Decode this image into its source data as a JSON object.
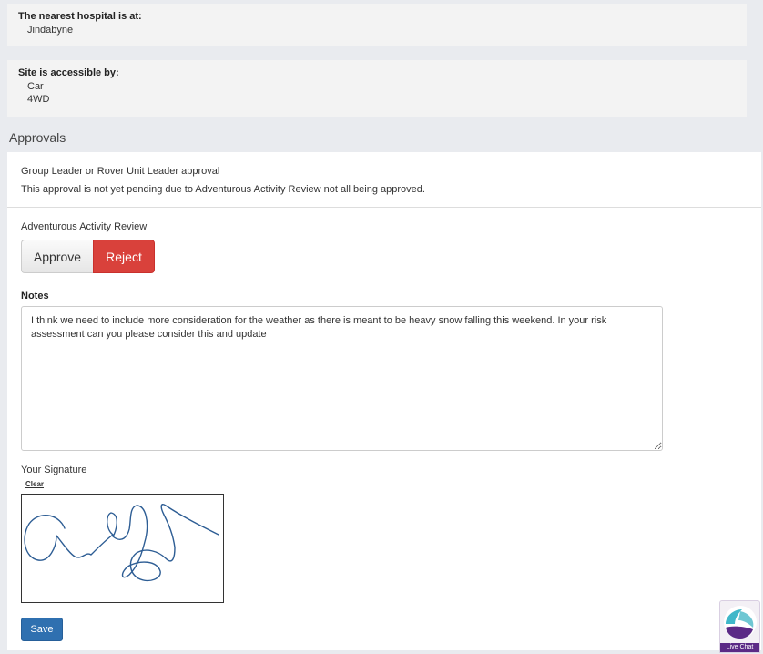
{
  "hospital": {
    "heading": "The nearest hospital is at:",
    "value": "Jindabyne"
  },
  "access": {
    "heading": "Site is accessible by:",
    "values": [
      "Car",
      "4WD"
    ]
  },
  "approvals": {
    "title": "Approvals",
    "leader_title": "Group Leader or Rover Unit Leader approval",
    "pending_message": "This approval is not yet pending due to Adventurous Activity Review not all being approved.",
    "review_label": "Adventurous Activity Review",
    "approve_label": "Approve",
    "reject_label": "Reject",
    "notes_label": "Notes",
    "notes_value": "I think we need to include more consideration for the weather as there is meant to be heavy snow falling this weekend. In your risk assessment can you please consider this and update",
    "signature_label": "Your Signature",
    "clear_label": "Clear",
    "save_label": "Save"
  },
  "live_chat": {
    "label": "Live Chat",
    "icon": "live-chat-logo-icon"
  },
  "colors": {
    "reject": "#d9413b",
    "save": "#2f70b0",
    "live_chat": "#5b2a86",
    "logo_teal": "#3fb7c9"
  }
}
